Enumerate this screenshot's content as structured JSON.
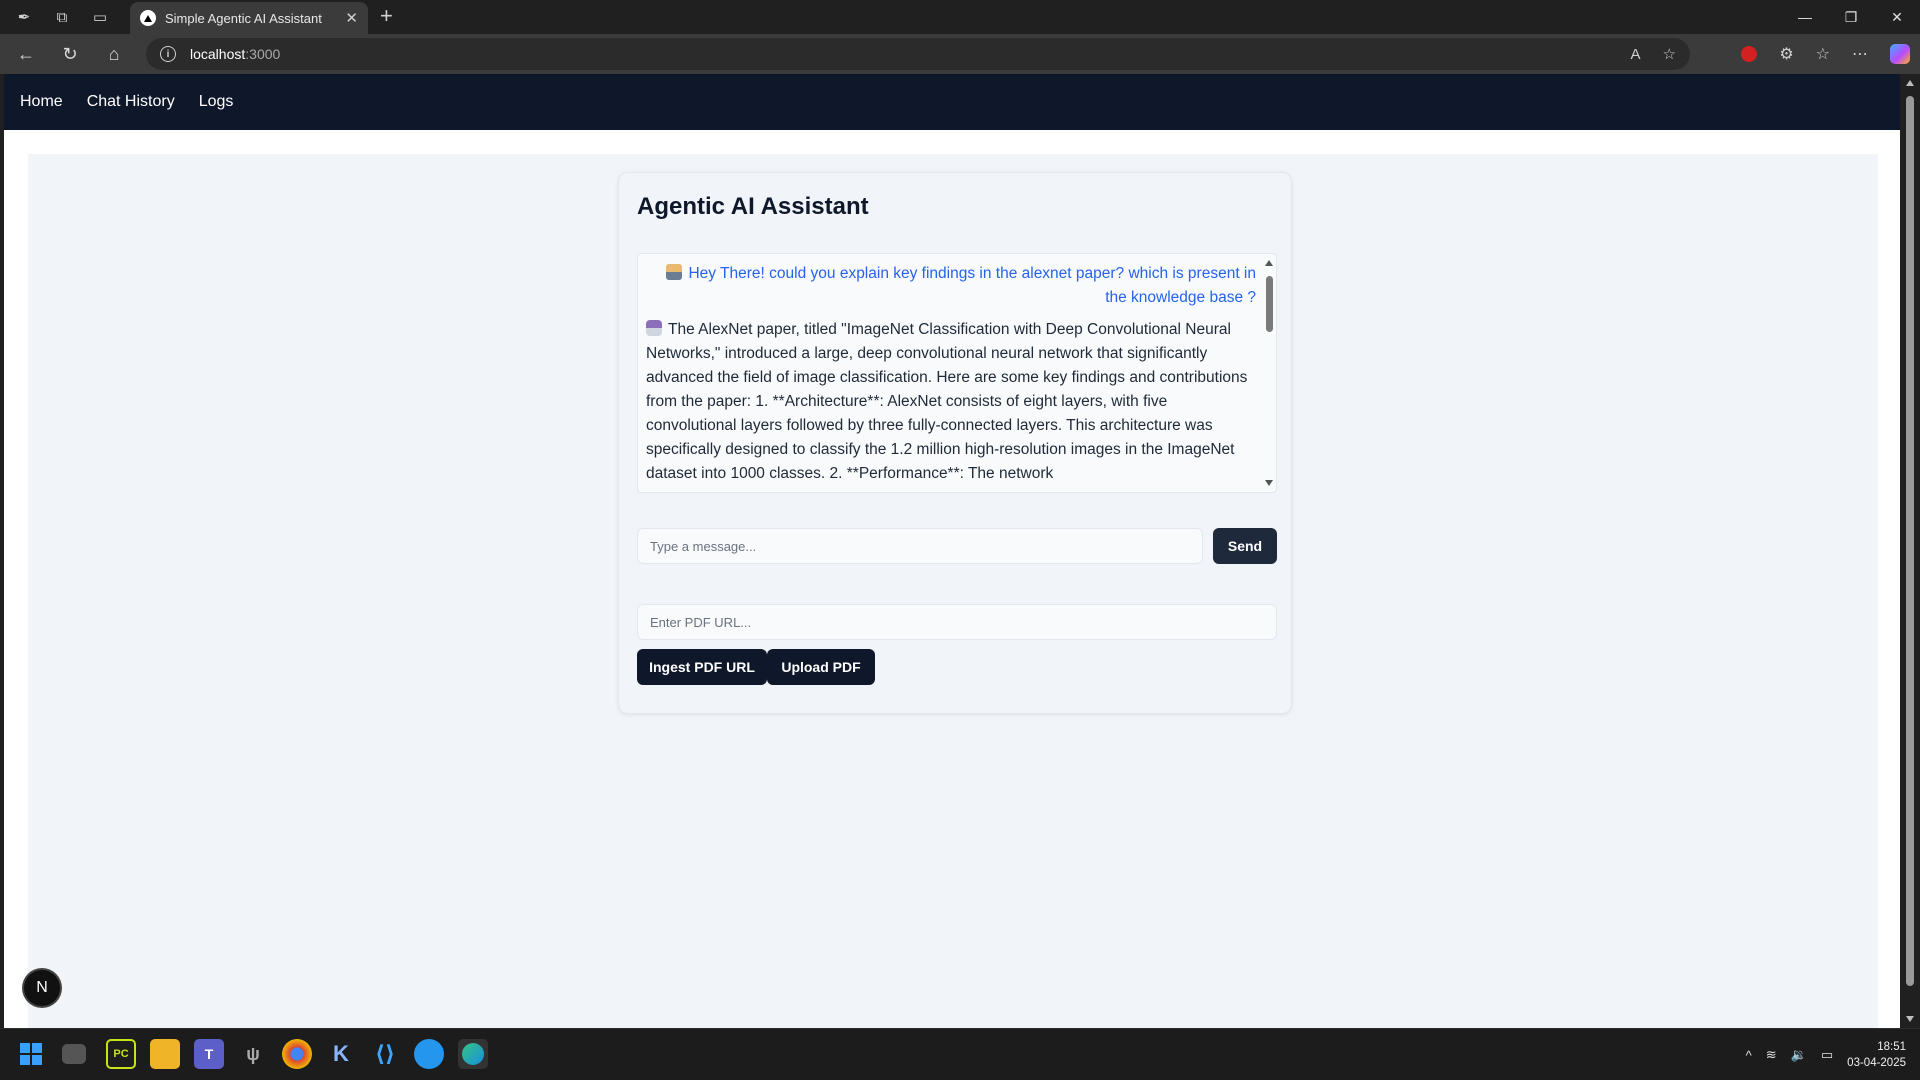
{
  "browser": {
    "tab_title": "Simple Agentic AI Assistant",
    "url_host": "localhost",
    "url_port": ":3000"
  },
  "navbar": {
    "items": [
      {
        "label": "Home"
      },
      {
        "label": "Chat History"
      },
      {
        "label": "Logs"
      }
    ]
  },
  "card": {
    "title": "Agentic AI Assistant"
  },
  "chat": {
    "messages": [
      {
        "role": "user",
        "text": "Hey There! could you explain key findings in the alexnet paper? which is present in the knowledge base ?"
      },
      {
        "role": "assistant",
        "text": "The AlexNet paper, titled \"ImageNet Classification with Deep Convolutional Neural Networks,\" introduced a large, deep convolutional neural network that significantly advanced the field of image classification. Here are some key findings and contributions from the paper: 1. **Architecture**: AlexNet consists of eight layers, with five convolutional layers followed by three fully-connected layers. This architecture was specifically designed to classify the 1.2 million high-resolution images in the ImageNet dataset into 1000 classes. 2. **Performance**: The network"
      }
    ]
  },
  "composer": {
    "placeholder": "Type a message...",
    "value": "",
    "send_label": "Send"
  },
  "pdf": {
    "placeholder": "Enter PDF URL...",
    "value": "",
    "ingest_label": "Ingest PDF URL",
    "upload_label": "Upload PDF"
  },
  "dev_badge": "N",
  "taskbar": {
    "time": "18:51",
    "date": "03-04-2025"
  },
  "colors": {
    "navbar_bg": "#0f172a",
    "user_message": "#2563eb",
    "button_bg": "#0f172a",
    "content_bg": "#f1f5f9"
  }
}
